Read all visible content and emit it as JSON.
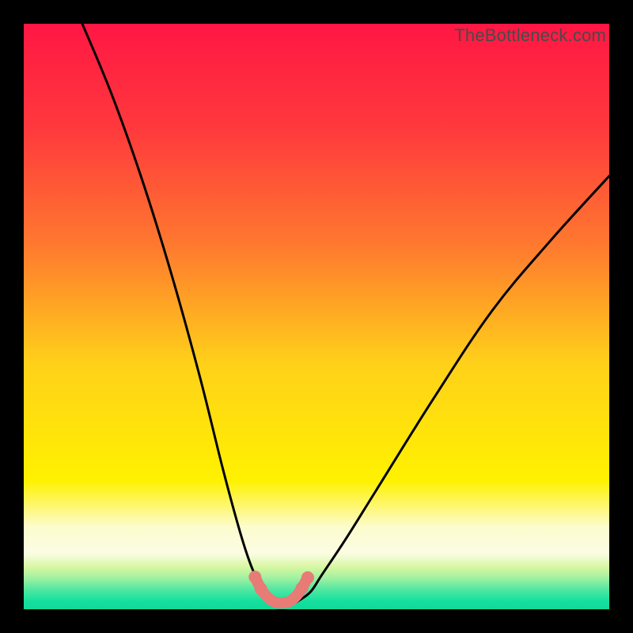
{
  "watermark": "TheBottleneck.com",
  "colors": {
    "black": "#000000",
    "curve_black": "#000000",
    "pink_segment": "#e77b76",
    "gradient_stops": [
      {
        "pos": 0.0,
        "color": "#ff1744"
      },
      {
        "pos": 0.18,
        "color": "#ff3a3d"
      },
      {
        "pos": 0.38,
        "color": "#ff7a2f"
      },
      {
        "pos": 0.58,
        "color": "#ffd11a"
      },
      {
        "pos": 0.78,
        "color": "#fff200"
      },
      {
        "pos": 0.86,
        "color": "#fdfccf"
      },
      {
        "pos": 0.905,
        "color": "#fbfde4"
      },
      {
        "pos": 0.928,
        "color": "#d8f7a2"
      },
      {
        "pos": 0.948,
        "color": "#9cf0a1"
      },
      {
        "pos": 0.965,
        "color": "#56e8a2"
      },
      {
        "pos": 0.985,
        "color": "#17e19e"
      },
      {
        "pos": 1.0,
        "color": "#10d99a"
      }
    ]
  },
  "chart_data": {
    "type": "line",
    "title": "",
    "xlabel": "",
    "ylabel": "",
    "xlim": [
      0,
      100
    ],
    "ylim": [
      0,
      100
    ],
    "note": "Bottleneck-percentage curve. Y=0 (bottom/green) means balanced; higher Y (red) means larger bottleneck. V-shape with minimum near x≈42–47.",
    "series": [
      {
        "name": "bottleneck-curve",
        "x": [
          10,
          15,
          20,
          25,
          30,
          34,
          37,
          39,
          41,
          42,
          44,
          46,
          47,
          49,
          51,
          55,
          60,
          70,
          80,
          90,
          100
        ],
        "y": [
          100,
          88,
          74,
          58,
          40,
          24,
          13,
          7,
          3,
          1.5,
          1,
          1,
          1.5,
          3,
          6,
          12,
          20,
          36,
          51,
          63,
          74
        ]
      }
    ],
    "highlight_segment": {
      "name": "optimal-zone",
      "x": [
        39.5,
        40.5,
        41.5,
        42.5,
        43.5,
        44.5,
        45.5,
        46.5,
        47.5,
        48.5
      ],
      "y": [
        5.5,
        3.5,
        2.2,
        1.4,
        1.1,
        1.1,
        1.4,
        2.2,
        3.6,
        5.4
      ],
      "color": "#e77b76"
    }
  }
}
